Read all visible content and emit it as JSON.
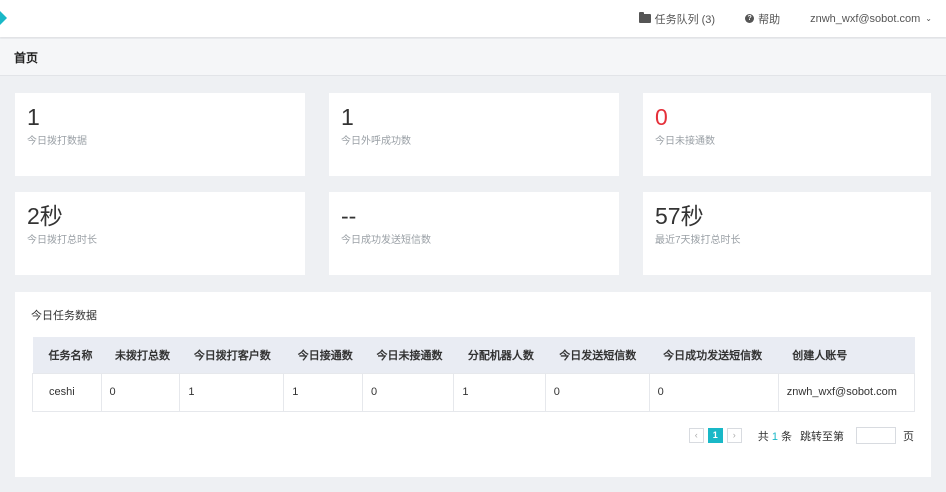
{
  "topbar": {
    "task_queue": "任务队列 (3)",
    "help": "帮助",
    "account": "znwh_wxf@sobot.com",
    "icons": {
      "logo": "logo-triangle",
      "task": "folder-icon",
      "help": "help-circle-icon",
      "account": "chevron-down-icon"
    }
  },
  "page_title": "首页",
  "stats": [
    {
      "value": "1",
      "label": "今日拨打数据"
    },
    {
      "value": "1",
      "label": "今日外呼成功数"
    },
    {
      "value": "0",
      "label": "今日未接通数",
      "color": "#e5303a"
    },
    {
      "value": "2秒",
      "label": "今日拨打总时长"
    },
    {
      "value": "--",
      "label": "今日成功发送短信数"
    },
    {
      "value": "57秒",
      "label": "最近7天拨打总时长"
    }
  ],
  "tasks": {
    "title": "今日任务数据",
    "columns": [
      "任务名称",
      "未拨打总数",
      "今日拨打客户数",
      "今日接通数",
      "今日未接通数",
      "分配机器人数",
      "今日发送短信数",
      "今日成功发送短信数",
      "创建人账号"
    ],
    "rows": [
      [
        "ceshi",
        "0",
        "1",
        "1",
        "0",
        "1",
        "0",
        "0",
        "znwh_wxf@sobot.com"
      ]
    ]
  },
  "pager": {
    "prev": "‹",
    "current": "1",
    "next": "›",
    "total_prefix": "共",
    "total_count": "1",
    "total_suffix": "条",
    "jump_label": "跳转至第",
    "jump_value": "",
    "page_suffix": "页"
  },
  "colors": {
    "accent": "#19b8c7",
    "danger": "#e5303a"
  }
}
